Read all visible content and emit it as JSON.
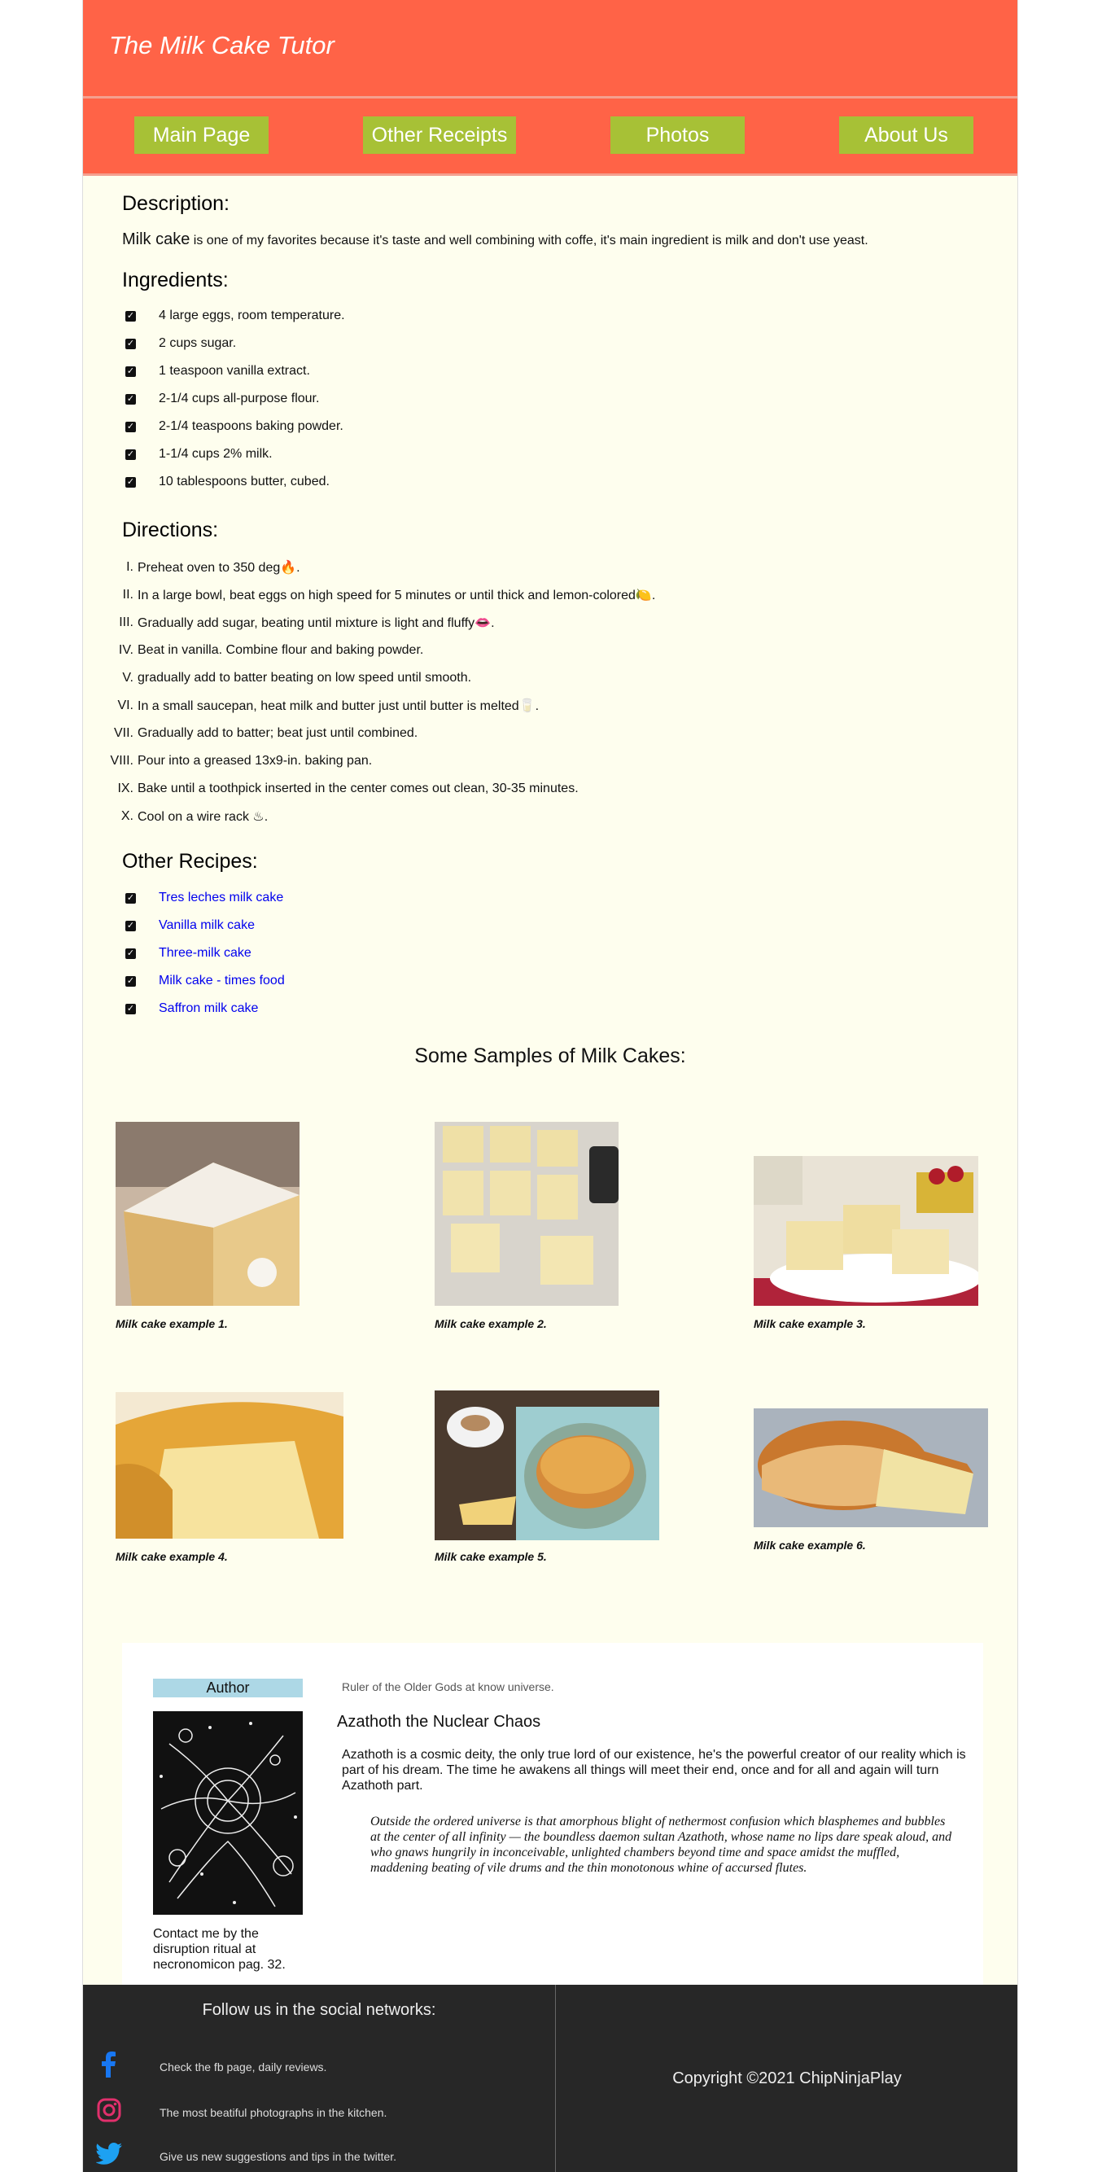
{
  "header": {
    "title": "The Milk Cake Tutor"
  },
  "nav": {
    "items": [
      {
        "label": "Main Page"
      },
      {
        "label": "Other Receipts"
      },
      {
        "label": "Photos"
      },
      {
        "label": "About Us"
      }
    ]
  },
  "description": {
    "heading": "Description:",
    "lead": "Milk cake",
    "text": " is one of my favorites because it's taste and well combining with coffe, it's main ingredient is milk and don't use yeast."
  },
  "ingredients": {
    "heading": "Ingredients:",
    "items": [
      "4 large eggs, room temperature.",
      "2 cups sugar.",
      "1 teaspoon vanilla extract.",
      "2-1/4 cups all-purpose flour.",
      "2-1/4 teaspoons baking powder.",
      "1-1/4 cups 2% milk.",
      "10 tablespoons butter, cubed."
    ]
  },
  "directions": {
    "heading": "Directions:",
    "items": [
      {
        "num": "I.",
        "text": "Preheat oven to 350 deg🔥."
      },
      {
        "num": "II.",
        "text": "In a large bowl, beat eggs on high speed for 5 minutes or until thick and lemon-colored🍋."
      },
      {
        "num": "III.",
        "text": "Gradually add sugar, beating until mixture is light and fluffy👄."
      },
      {
        "num": "IV.",
        "text": "Beat in vanilla. Combine flour and baking powder."
      },
      {
        "num": "V.",
        "text": "gradually add to batter beating on low speed until smooth."
      },
      {
        "num": "VI.",
        "text": "In a small saucepan, heat milk and butter just until butter is melted🥛."
      },
      {
        "num": "VII.",
        "text": "Gradually add to batter; beat just until combined."
      },
      {
        "num": "VIII.",
        "text": "Pour into a greased 13x9-in. baking pan."
      },
      {
        "num": "IX.",
        "text": "Bake until a toothpick inserted in the center comes out clean, 30-35 minutes."
      },
      {
        "num": "X.",
        "text": "Cool on a wire rack ♨."
      }
    ]
  },
  "other_recipes": {
    "heading": "Other Recipes:",
    "items": [
      "Tres leches milk cake",
      "Vanilla milk cake",
      "Three-milk cake",
      "Milk cake - times food",
      "Saffron milk cake"
    ]
  },
  "samples": {
    "heading": "Some Samples of Milk Cakes:",
    "captions": [
      "Milk cake example 1.",
      "Milk cake example 2.",
      "Milk cake example 3.",
      "Milk cake example 4.",
      "Milk cake example 5.",
      "Milk cake example 6."
    ]
  },
  "author": {
    "label": "Author",
    "tagline": "Ruler of the Older Gods at know universe.",
    "name": "Azathoth the Nuclear Chaos",
    "bio": "Azathoth is a cosmic deity, the only true lord of our existence, he's the powerful creator of our reality which is part of his dream. The time he awakens all things will meet their end, once and for all and again will turn Azathoth part.",
    "quote": "Outside the ordered universe is that amorphous blight of nethermost confusion which blasphemes and bubbles at the center of all infinity — the boundless daemon sultan Azathoth, whose name no lips dare speak aloud, and who gnaws hungrily in inconceivable, unlighted chambers beyond time and space amidst the muffled, maddening beating of vile drums and the thin monotonous whine of accursed flutes.",
    "contact": "Contact me by the disruption ritual at necronomicon pag. 32."
  },
  "footer": {
    "follow_title": "Follow us in the social networks:",
    "social": [
      {
        "icon": "facebook-icon",
        "text": "Check the fb page, daily reviews."
      },
      {
        "icon": "instagram-icon",
        "text": "The most beatiful photographs in the kitchen."
      },
      {
        "icon": "twitter-icon",
        "text": "Give us new suggestions and tips in the twitter."
      }
    ],
    "copyright": "Copyright ©2021 ChipNinjaPlay"
  },
  "colors": {
    "header_bg": "#ff6347",
    "nav_button_bg": "#a7c136",
    "page_bg": "#fefeee",
    "footer_bg": "#272727",
    "link": "#0000ee"
  }
}
